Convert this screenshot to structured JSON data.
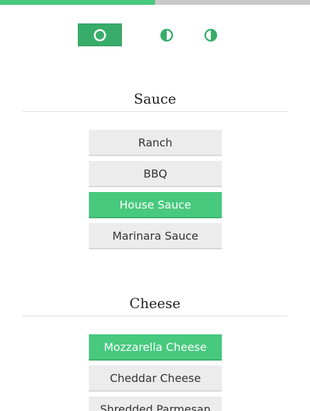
{
  "progress": {
    "fraction": 0.5,
    "fill_color": "#47c97e",
    "track_color": "#c8c8c8"
  },
  "coverage": {
    "options": [
      {
        "icon": "whole-circle-icon",
        "selected": true
      },
      {
        "icon": "left-half-circle-icon",
        "selected": false
      },
      {
        "icon": "right-half-circle-icon",
        "selected": false
      }
    ],
    "accent": "#38ad6b"
  },
  "sections": [
    {
      "title": "Sauce",
      "options": [
        {
          "label": "Ranch",
          "selected": false
        },
        {
          "label": "BBQ",
          "selected": false
        },
        {
          "label": "House Sauce",
          "selected": true
        },
        {
          "label": "Marinara Sauce",
          "selected": false
        }
      ]
    },
    {
      "title": "Cheese",
      "options": [
        {
          "label": "Mozzarella Cheese",
          "selected": true
        },
        {
          "label": "Cheddar Cheese",
          "selected": false
        },
        {
          "label": "Shredded Parmesan",
          "selected": false
        }
      ]
    }
  ],
  "colors": {
    "selected": "#47c97e",
    "unselected": "#ececec"
  }
}
